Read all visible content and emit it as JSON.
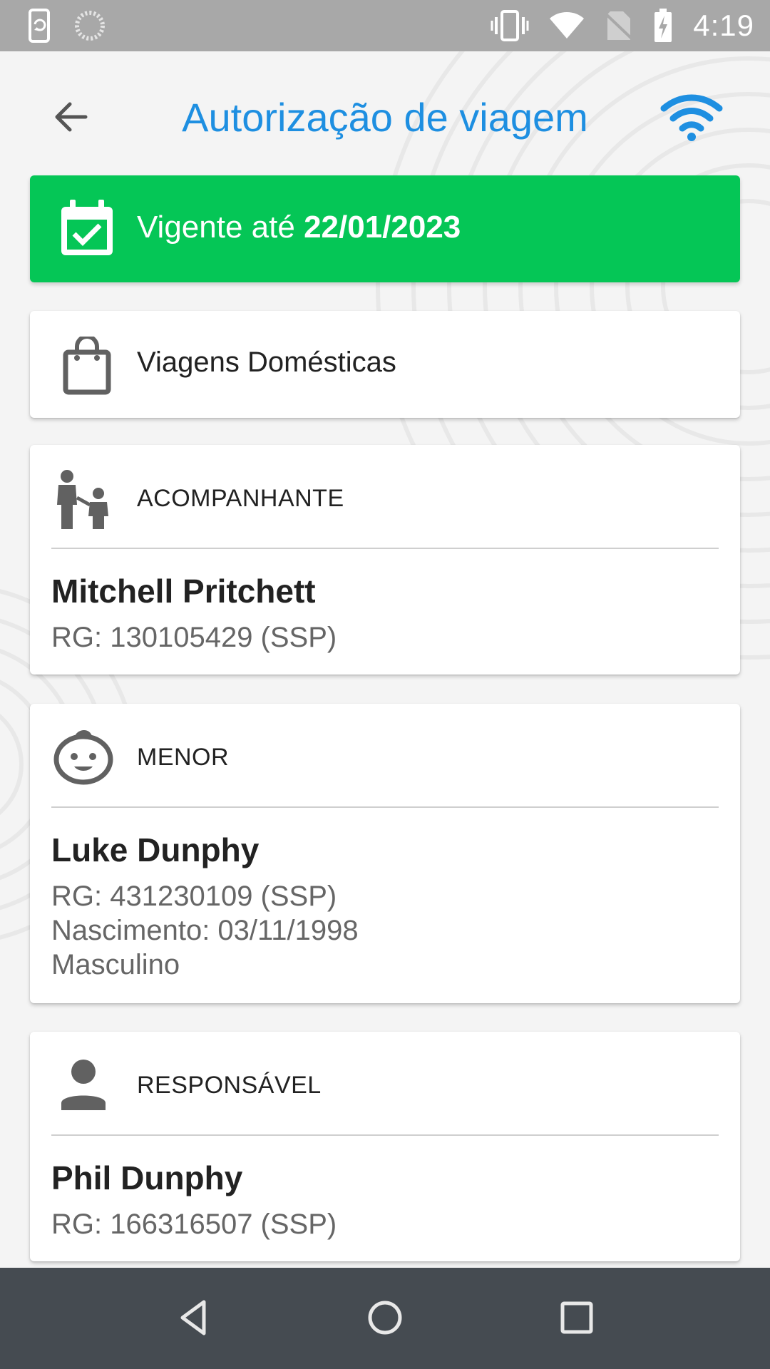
{
  "status_bar": {
    "time": "4:19",
    "left_icons": [
      "phone-rotate-icon",
      "loading-icon"
    ],
    "right_icons": [
      "vibrate-icon",
      "wifi-icon",
      "no-sim-icon",
      "battery-charging-icon"
    ]
  },
  "app_bar": {
    "title": "Autorização de viagem",
    "back_icon": "arrow-back-icon",
    "connection_icon": "wifi-icon"
  },
  "validity": {
    "label": "Vigente até",
    "date": "22/01/2023",
    "icon": "calendar-check-icon",
    "color": "#05c656"
  },
  "trip_type": {
    "label": "Viagens Domésticas",
    "icon": "shopping-bag-icon"
  },
  "companion": {
    "section": "ACOMPANHANTE",
    "icon": "parent-child-icon",
    "name": "Mitchell Pritchett",
    "rg": "RG: 130105429 (SSP)"
  },
  "minor": {
    "section": "MENOR",
    "icon": "child-face-icon",
    "name": "Luke Dunphy",
    "rg": "RG: 431230109 (SSP)",
    "birth": "Nascimento: 03/11/1998",
    "gender": "Masculino"
  },
  "guardian": {
    "section": "RESPONSÁVEL",
    "icon": "person-icon",
    "name": "Phil Dunphy",
    "rg": "RG: 166316507 (SSP)"
  },
  "nav_bar": {
    "buttons": [
      "back-triangle-icon",
      "home-circle-icon",
      "recents-square-icon"
    ]
  },
  "colors": {
    "accent": "#1e8fe1",
    "valid": "#05c656",
    "nav": "#454b51",
    "status": "#a8a8a8"
  }
}
